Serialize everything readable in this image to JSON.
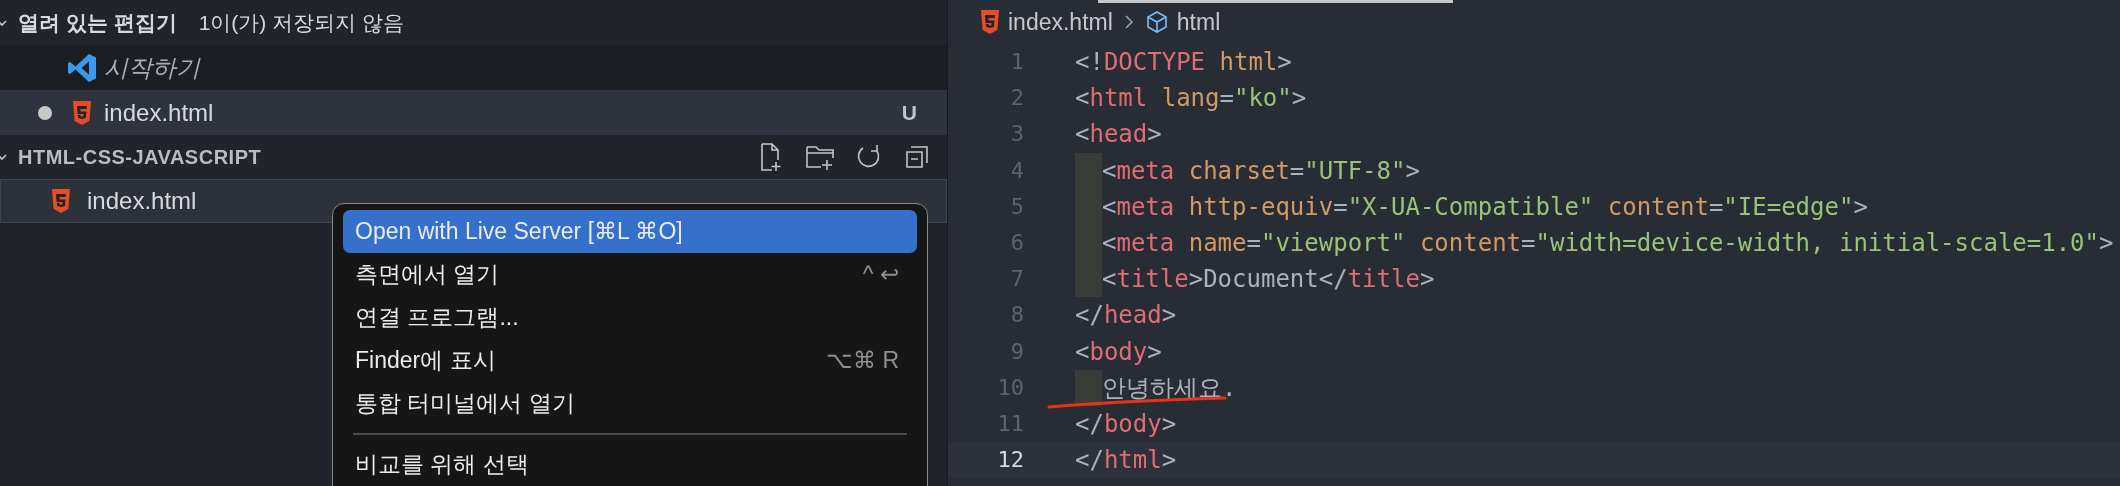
{
  "open_editors": {
    "title": "열려 있는 편집기",
    "badge": "1이(가) 저장되지 않음",
    "expanded": true,
    "items": [
      {
        "kind": "welcome",
        "name": "시작하기",
        "preview": true,
        "unsaved": false,
        "selected": false
      },
      {
        "kind": "html",
        "name": "index.html",
        "preview": false,
        "unsaved": true,
        "status": "U",
        "selected": true
      }
    ]
  },
  "explorer": {
    "title": "HTML-CSS-JAVASCRIPT",
    "expanded": true,
    "items": [
      {
        "kind": "html",
        "name": "index.html",
        "focused": true
      }
    ]
  },
  "context_menu": {
    "items": [
      {
        "kind": "item",
        "label": "Open with Live Server [⌘L ⌘O]",
        "selected": true
      },
      {
        "kind": "item",
        "label": "측면에서 열기",
        "shortcut": "^ ↩",
        "selected": false
      },
      {
        "kind": "item",
        "label": "연결 프로그램...",
        "selected": false
      },
      {
        "kind": "item",
        "label": "Finder에 표시",
        "shortcut": "⌥⌘ R",
        "selected": false
      },
      {
        "kind": "item",
        "label": "통합 터미널에서 열기",
        "selected": false
      },
      {
        "kind": "separator"
      },
      {
        "kind": "item",
        "label": "비교를 위해 선택",
        "selected": false
      }
    ]
  },
  "breadcrumb": [
    {
      "kind": "file",
      "label": "index.html"
    },
    {
      "kind": "element",
      "label": "html"
    }
  ],
  "editor": {
    "lines": [
      {
        "number": "1",
        "indented": false,
        "current": false,
        "marked": false,
        "tokens": [
          {
            "kind": "punct",
            "text": "<!"
          },
          {
            "kind": "tag",
            "text": "DOCTYPE"
          },
          {
            "kind": "attr",
            "text": " html"
          },
          {
            "kind": "punct",
            "text": ">"
          }
        ]
      },
      {
        "number": "2",
        "indented": false,
        "current": false,
        "marked": false,
        "tokens": [
          {
            "kind": "punct",
            "text": "<"
          },
          {
            "kind": "tag",
            "text": "html"
          },
          {
            "kind": "attr",
            "text": " lang"
          },
          {
            "kind": "punct",
            "text": "="
          },
          {
            "kind": "string",
            "text": "\"ko\""
          },
          {
            "kind": "punct",
            "text": ">"
          }
        ]
      },
      {
        "number": "3",
        "indented": false,
        "current": false,
        "marked": false,
        "tokens": [
          {
            "kind": "punct",
            "text": "<"
          },
          {
            "kind": "tag",
            "text": "head"
          },
          {
            "kind": "punct",
            "text": ">"
          }
        ]
      },
      {
        "number": "4",
        "indented": true,
        "current": false,
        "marked": false,
        "tokens": [
          {
            "kind": "punct",
            "text": "<"
          },
          {
            "kind": "tag",
            "text": "meta"
          },
          {
            "kind": "attr",
            "text": " charset"
          },
          {
            "kind": "punct",
            "text": "="
          },
          {
            "kind": "string",
            "text": "\"UTF-8\""
          },
          {
            "kind": "punct",
            "text": ">"
          }
        ]
      },
      {
        "number": "5",
        "indented": true,
        "current": false,
        "marked": false,
        "tokens": [
          {
            "kind": "punct",
            "text": "<"
          },
          {
            "kind": "tag",
            "text": "meta"
          },
          {
            "kind": "attr",
            "text": " http-equiv"
          },
          {
            "kind": "punct",
            "text": "="
          },
          {
            "kind": "string",
            "text": "\"X-UA-Compatible\""
          },
          {
            "kind": "attr",
            "text": " content"
          },
          {
            "kind": "punct",
            "text": "="
          },
          {
            "kind": "string",
            "text": "\"IE=edge\""
          },
          {
            "kind": "punct",
            "text": ">"
          }
        ]
      },
      {
        "number": "6",
        "indented": true,
        "current": false,
        "marked": false,
        "tokens": [
          {
            "kind": "punct",
            "text": "<"
          },
          {
            "kind": "tag",
            "text": "meta"
          },
          {
            "kind": "attr",
            "text": " name"
          },
          {
            "kind": "punct",
            "text": "="
          },
          {
            "kind": "string",
            "text": "\"viewport\""
          },
          {
            "kind": "attr",
            "text": " content"
          },
          {
            "kind": "punct",
            "text": "="
          },
          {
            "kind": "string",
            "text": "\"width=device-width, initial-scale=1.0\""
          },
          {
            "kind": "punct",
            "text": ">"
          }
        ]
      },
      {
        "number": "7",
        "indented": true,
        "current": false,
        "marked": false,
        "tokens": [
          {
            "kind": "punct",
            "text": "<"
          },
          {
            "kind": "tag",
            "text": "title"
          },
          {
            "kind": "punct",
            "text": ">"
          },
          {
            "kind": "text",
            "text": "Document"
          },
          {
            "kind": "punct",
            "text": "</"
          },
          {
            "kind": "tag",
            "text": "title"
          },
          {
            "kind": "punct",
            "text": ">"
          }
        ]
      },
      {
        "number": "8",
        "indented": false,
        "current": false,
        "marked": false,
        "tokens": [
          {
            "kind": "punct",
            "text": "</"
          },
          {
            "kind": "tag",
            "text": "head"
          },
          {
            "kind": "punct",
            "text": ">"
          }
        ]
      },
      {
        "number": "9",
        "indented": false,
        "current": false,
        "marked": false,
        "tokens": [
          {
            "kind": "punct",
            "text": "<"
          },
          {
            "kind": "tag",
            "text": "body"
          },
          {
            "kind": "punct",
            "text": ">"
          }
        ]
      },
      {
        "number": "10",
        "indented": true,
        "current": false,
        "marked": true,
        "tokens": [
          {
            "kind": "text",
            "text": "안녕하세요."
          }
        ]
      },
      {
        "number": "11",
        "indented": false,
        "current": false,
        "marked": false,
        "tokens": [
          {
            "kind": "punct",
            "text": "</"
          },
          {
            "kind": "tag",
            "text": "body"
          },
          {
            "kind": "punct",
            "text": ">"
          }
        ]
      },
      {
        "number": "12",
        "indented": false,
        "current": true,
        "marked": false,
        "tokens": [
          {
            "kind": "punct",
            "text": "</"
          },
          {
            "kind": "tag",
            "text": "html"
          },
          {
            "kind": "punct",
            "text": ">"
          }
        ]
      }
    ]
  }
}
